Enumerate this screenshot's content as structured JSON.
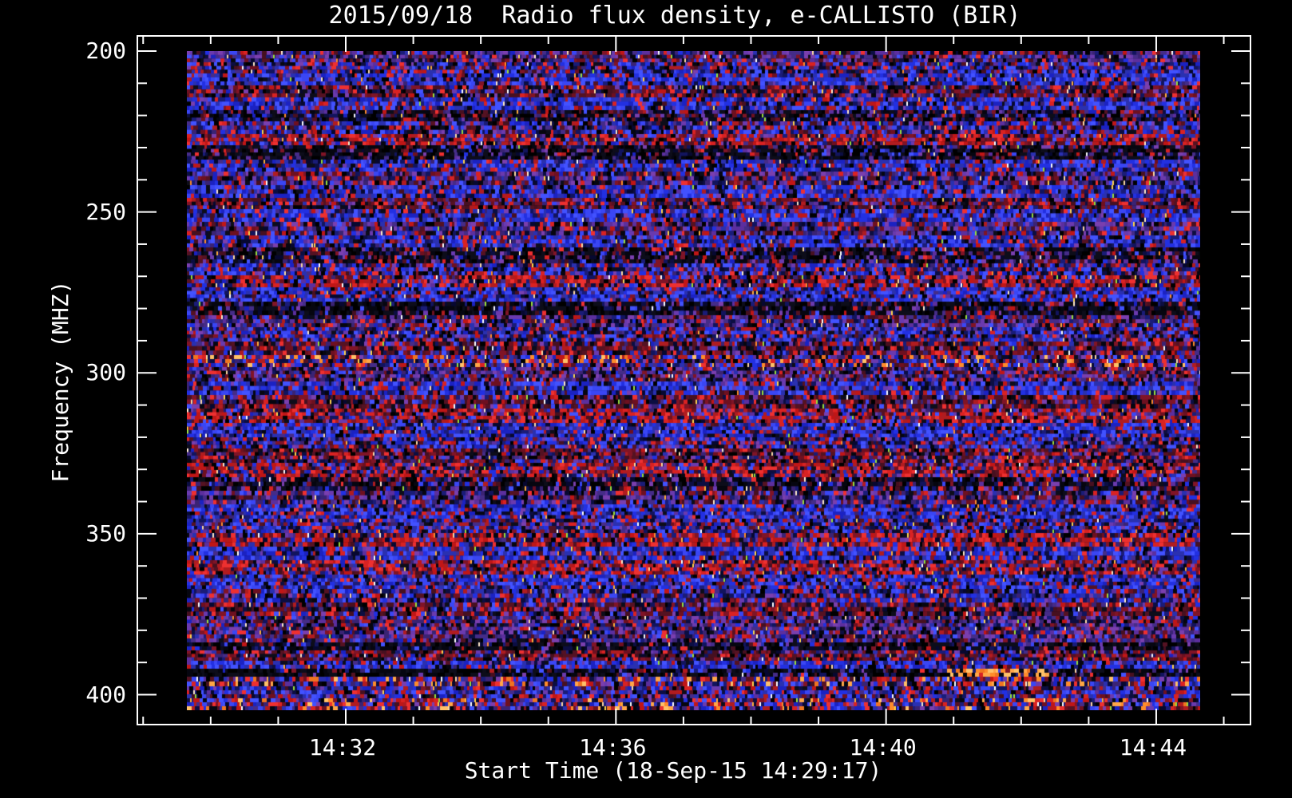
{
  "chart_data": {
    "type": "heatmap",
    "subtype": "radio-spectrogram",
    "title": "2015/09/18  Radio flux density, e-CALLISTO (BIR)",
    "xlabel": "Start Time (18-Sep-15 14:29:17)",
    "ylabel": "Frequency (MHZ)",
    "date": "2015/09/18",
    "instrument": "e-CALLISTO",
    "station": "BIR",
    "start_time": "14:29:17",
    "legend": "none",
    "grid": "off",
    "x_axis": {
      "major_tick_labels": [
        "14:32",
        "14:36",
        "14:40",
        "14:44"
      ],
      "major_tick_minutes": [
        32,
        36,
        40,
        44
      ],
      "minor_tick_minutes": [
        29,
        30,
        31,
        32,
        33,
        34,
        35,
        36,
        37,
        38,
        39,
        40,
        41,
        42,
        43,
        44,
        45
      ],
      "minor_interval_seconds": 60
    },
    "y_axis": {
      "unit": "MHz",
      "direction": "increasing-downward",
      "major_ticks": [
        200,
        250,
        300,
        350,
        400
      ],
      "major_tick_labels": [
        "200",
        "250",
        "300",
        "350",
        "400"
      ],
      "minor_step": 10,
      "data_top_mhz": 200,
      "data_bottom_mhz": 405
    },
    "colors": {
      "background": "#000000",
      "axis": "#ffffff",
      "text": "#ffffff"
    },
    "palette": {
      "blue": [
        "#2230e2",
        "#3a46f4",
        "#1b22c2",
        "#2a30b0",
        "#4252ff"
      ],
      "navy": [
        "#12145e",
        "#0c0e42",
        "#1a1c78",
        "#070830"
      ],
      "purple": [
        "#5c2f9e",
        "#452c88",
        "#6a3aae",
        "#3a2374",
        "#7a3fae"
      ],
      "red": [
        "#d92222",
        "#c01616",
        "#ee3030",
        "#b01c20"
      ],
      "maroon": [
        "#6e1020",
        "#551222",
        "#801426",
        "#471020"
      ],
      "black": [
        "#000000",
        "#060610",
        "#0d0d1a"
      ],
      "orange": [
        "#ff8c2a",
        "#ffa648",
        "#f07420",
        "#ffc168"
      ],
      "spark": [
        "#ffd34d",
        "#ffae3a",
        "#ffd9a2",
        "#ffe9c9",
        "#ffffff",
        "#ff8c2a",
        "#9adf3a"
      ]
    },
    "band_codes": {
      "B": "blue-dominant",
      "b": "blue-mixed",
      "P": "purple-dominant",
      "R": "red-bright",
      "r": "dark-red",
      "D": "dark",
      "S": "very-dark-sparse",
      "M": "bright-mixed"
    },
    "band_weights": {
      "B": {
        "blue": 55,
        "navy": 13,
        "purple": 8,
        "red": 9,
        "maroon": 5,
        "black": 8,
        "spark": 2
      },
      "b": {
        "blue": 34,
        "navy": 14,
        "purple": 16,
        "red": 12,
        "maroon": 10,
        "black": 12,
        "spark": 2
      },
      "P": {
        "purple": 34,
        "maroon": 15,
        "navy": 12,
        "blue": 13,
        "red": 10,
        "black": 13,
        "spark": 3
      },
      "R": {
        "red": 38,
        "maroon": 18,
        "purple": 11,
        "blue": 12,
        "navy": 6,
        "black": 12,
        "spark": 3
      },
      "r": {
        "maroon": 33,
        "red": 16,
        "purple": 13,
        "navy": 10,
        "blue": 9,
        "black": 17,
        "spark": 2
      },
      "D": {
        "black": 42,
        "navy": 16,
        "maroon": 14,
        "purple": 12,
        "blue": 8,
        "red": 6,
        "spark": 2
      },
      "S": {
        "black": 58,
        "navy": 15,
        "purple": 9,
        "maroon": 8,
        "blue": 6,
        "red": 3,
        "spark": 1
      },
      "M": {
        "blue": 24,
        "red": 19,
        "purple": 14,
        "orange": 9,
        "navy": 9,
        "maroon": 10,
        "black": 9,
        "spark": 6
      }
    },
    "bands": [
      [
        14,
        "P"
      ],
      [
        14,
        "b"
      ],
      [
        15,
        "B"
      ],
      [
        15,
        "r"
      ],
      [
        16,
        "B"
      ],
      [
        14,
        "D"
      ],
      [
        16,
        "b"
      ],
      [
        14,
        "R"
      ],
      [
        18,
        "S"
      ],
      [
        15,
        "B"
      ],
      [
        17,
        "P"
      ],
      [
        16,
        "B"
      ],
      [
        14,
        "r"
      ],
      [
        16,
        "B"
      ],
      [
        17,
        "P"
      ],
      [
        15,
        "B"
      ],
      [
        20,
        "D"
      ],
      [
        15,
        "b"
      ],
      [
        15,
        "R"
      ],
      [
        18,
        "B"
      ],
      [
        17,
        "S"
      ],
      [
        15,
        "P"
      ],
      [
        18,
        "b"
      ],
      [
        17,
        "r"
      ],
      [
        15,
        "M"
      ],
      [
        18,
        "P"
      ],
      [
        17,
        "B"
      ],
      [
        17,
        "r"
      ],
      [
        18,
        "R"
      ],
      [
        18,
        "B"
      ],
      [
        14,
        "b"
      ],
      [
        18,
        "r"
      ],
      [
        18,
        "R"
      ],
      [
        17,
        "D"
      ],
      [
        17,
        "P"
      ],
      [
        18,
        "B"
      ],
      [
        18,
        "b"
      ],
      [
        17,
        "R"
      ],
      [
        17,
        "B"
      ],
      [
        18,
        "R"
      ],
      [
        18,
        "B"
      ],
      [
        17,
        "b"
      ],
      [
        17,
        "r"
      ],
      [
        18,
        "P"
      ],
      [
        15,
        "P"
      ],
      [
        10,
        "S"
      ],
      [
        13,
        "r"
      ],
      [
        10,
        "B"
      ],
      [
        10,
        "S"
      ],
      [
        12,
        "M"
      ],
      [
        15,
        "b"
      ],
      [
        15,
        "M"
      ]
    ],
    "special_features": {
      "bright_blue_row": {
        "band_index": 47,
        "approx_freq_mhz": 390
      },
      "black_patch": {
        "band_index": 48,
        "x_frac": [
          0.0,
          0.085
        ],
        "x_fade_frac": [
          0.085,
          0.28
        ]
      },
      "orange_patch": {
        "band_index": 48,
        "x_frac": [
          0.75,
          0.85
        ],
        "approx_freq_mhz": 393
      }
    }
  }
}
